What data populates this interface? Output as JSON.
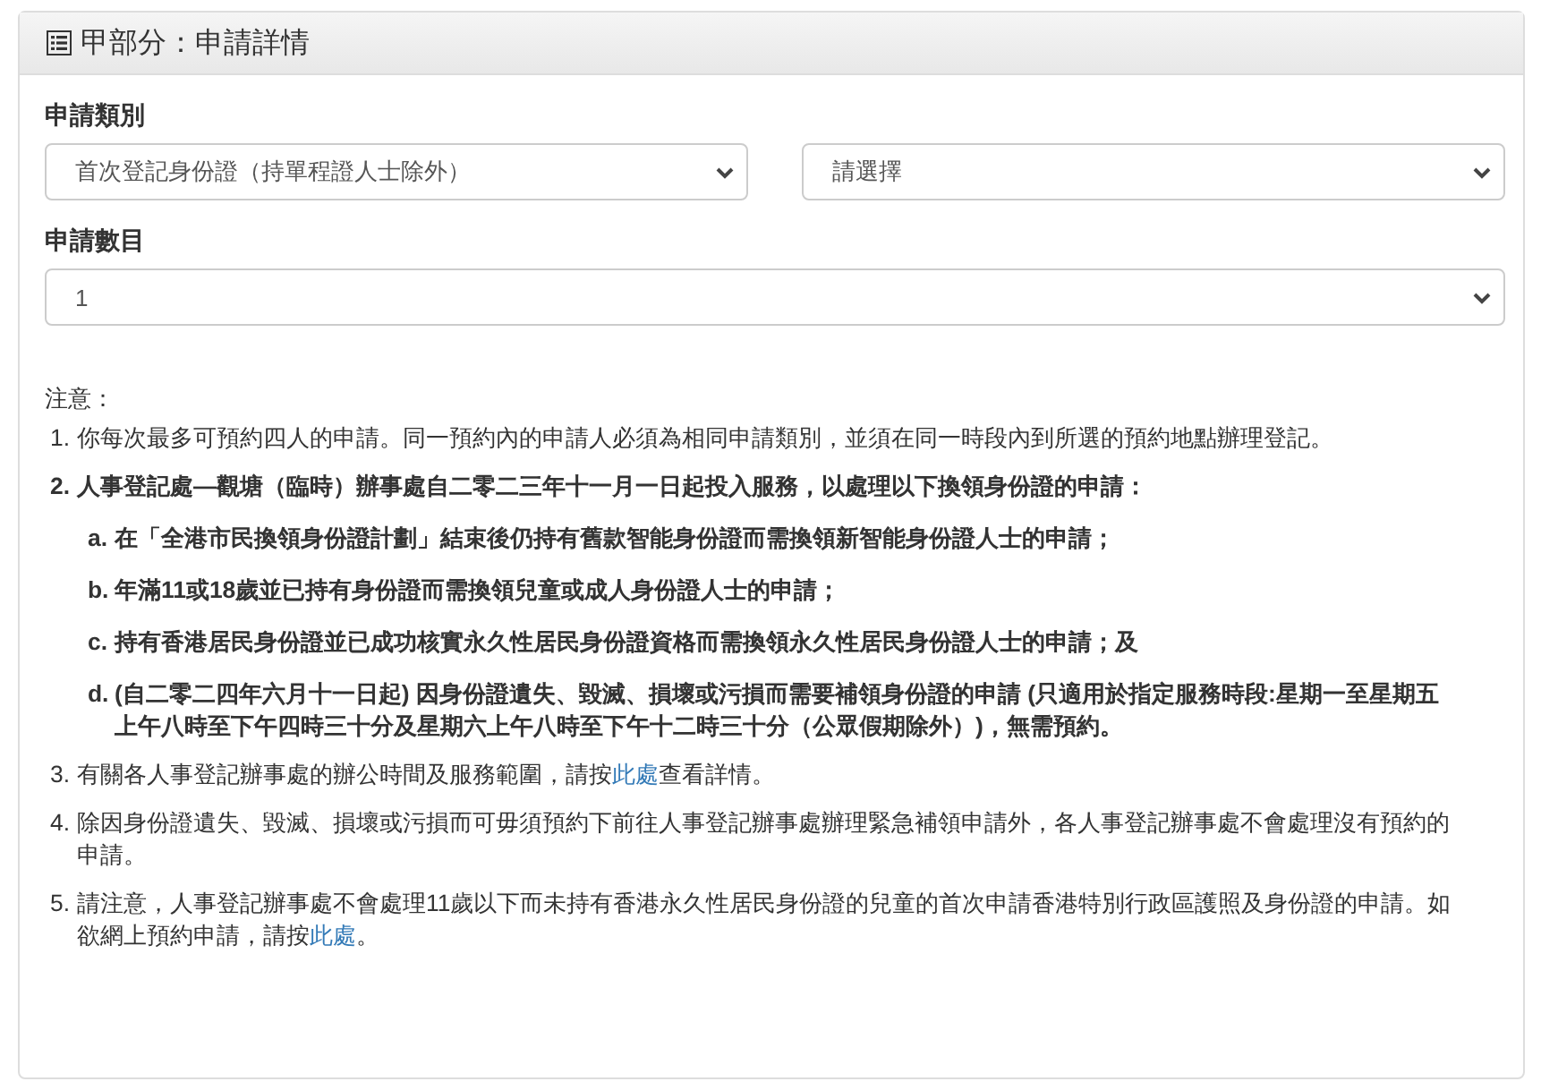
{
  "panel": {
    "title": "甲部分：申請詳情"
  },
  "fields": [
    {
      "label": "申請類別",
      "dropdowns": [
        {
          "value": "首次登記身份證（持單程證人士除外）"
        },
        {
          "value": "請選擇"
        }
      ]
    },
    {
      "label": "申請數目",
      "dropdowns": [
        {
          "value": "1"
        }
      ]
    }
  ],
  "notes": {
    "heading": "注意：",
    "items": [
      {
        "marker": "1.",
        "emphasis": false,
        "parts": [
          {
            "text": "你每次最多可預約四人的申請。同一預約內的申請人必須為相同申請類別，並須在同一時段內到所選的預約地點辦理登記。"
          }
        ]
      },
      {
        "marker": "2.",
        "emphasis": true,
        "parts": [
          {
            "text": "人事登記處—觀塘（臨時）辦事處自二零二三年十一月一日起投入服務，以處理以下換領身份證的申請："
          }
        ],
        "children": [
          {
            "marker": "a.",
            "parts": [
              {
                "text": "在「全港市民換領身份證計劃」結束後仍持有舊款智能身份證而需換領新智能身份證人士的申請；"
              }
            ]
          },
          {
            "marker": "b.",
            "parts": [
              {
                "text": "年滿11或18歲並已持有身份證而需換領兒童或成人身份證人士的申請；"
              }
            ]
          },
          {
            "marker": "c.",
            "parts": [
              {
                "text": "持有香港居民身份證並已成功核實永久性居民身份證資格而需換領永久性居民身份證人士的申請；及"
              }
            ]
          },
          {
            "marker": "d.",
            "parts": [
              {
                "text": "(自二零二四年六月十一日起) 因身份證遺失、毀滅、損壞或污損而需要補領身份證的申請 (只適用於指定服務時段:星期一至星期五上午八時至下午四時三十分及星期六上午八時至下午十二時三十分（公眾假期除外）)，無需預約。"
              }
            ]
          }
        ]
      },
      {
        "marker": "3.",
        "emphasis": false,
        "parts": [
          {
            "text": "有關各人事登記辦事處的辦公時間及服務範圍，請按"
          },
          {
            "text": "此處",
            "kind": "link"
          },
          {
            "text": "查看詳情。"
          }
        ]
      },
      {
        "marker": "4.",
        "emphasis": false,
        "parts": [
          {
            "text": "除因身份證遺失、毀滅、損壞或污損而可毋須預約下前往人事登記辦事處辦理緊急補領申請外，各人事登記辦事處不會處理沒有預約的申請。"
          }
        ]
      },
      {
        "marker": "5.",
        "emphasis": false,
        "parts": [
          {
            "text": "請注意，人事登記辦事處不會處理11歲以下而未持有香港永久性居民身份證的兒童的首次申請香港特別行政區護照及身份證的申請。如欲網上預約申請，請按"
          },
          {
            "text": "此處",
            "kind": "link"
          },
          {
            "text": "。"
          }
        ]
      }
    ]
  }
}
